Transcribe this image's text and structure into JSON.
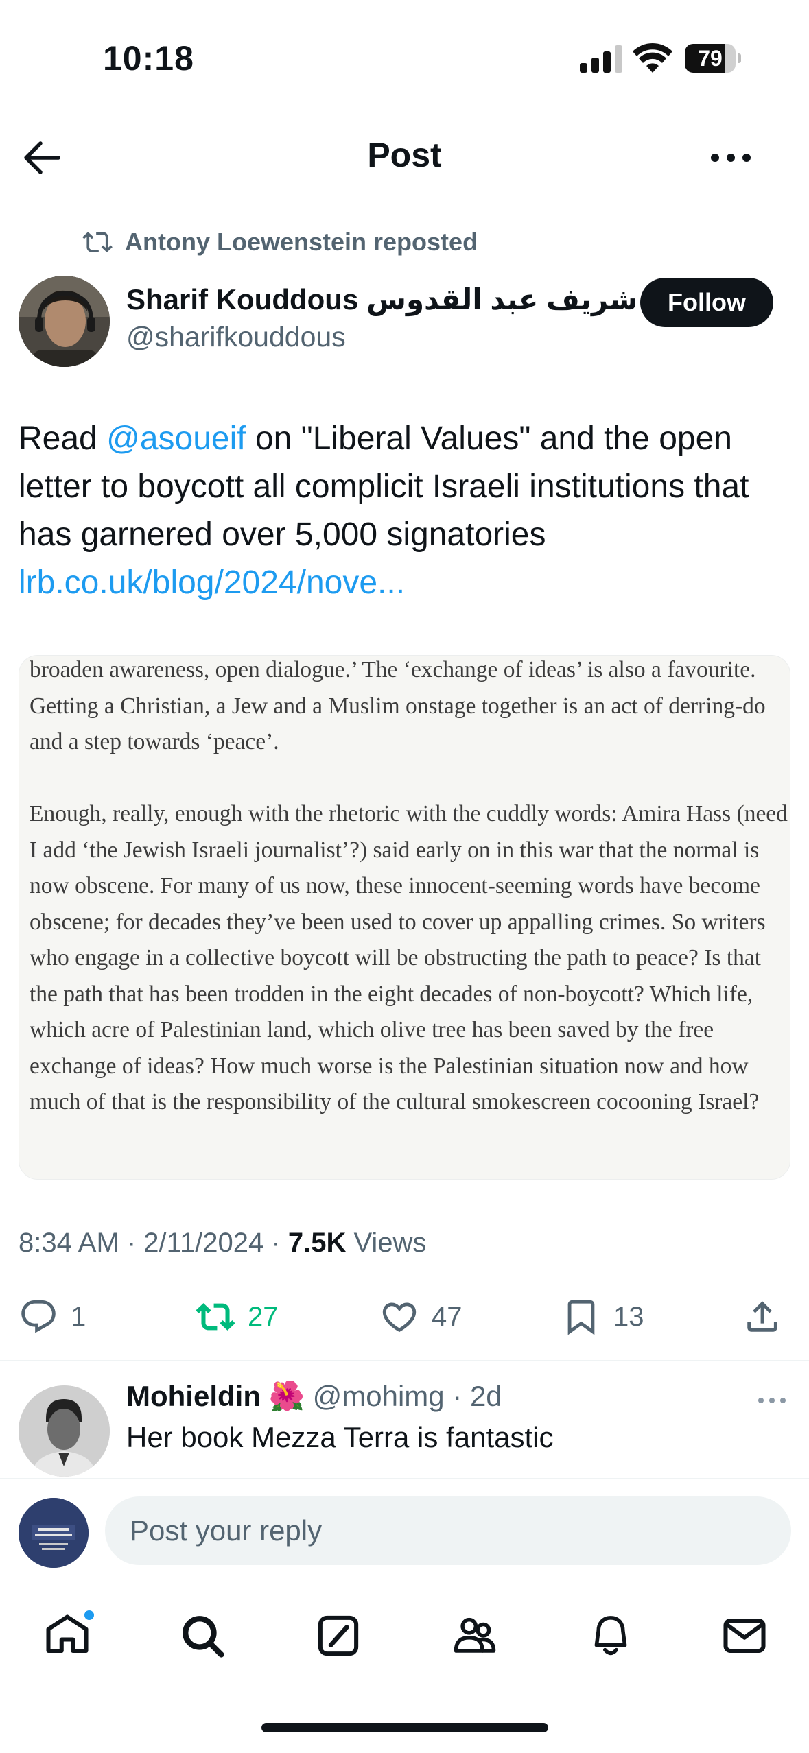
{
  "status_bar": {
    "time": "10:18",
    "battery": "79",
    "battery_level": 0.79
  },
  "header": {
    "title": "Post"
  },
  "repost": {
    "text": "Antony Loewenstein reposted"
  },
  "author": {
    "name": "Sharif Kouddous شريف عبد القدوس",
    "handle": "@sharifkouddous",
    "follow_label": "Follow"
  },
  "tweet": {
    "text_before_mention": "Read ",
    "mention": "@asoueif",
    "text_after_mention": " on \"Liberal Values\" and the open letter to boycott all complicit Israeli institutions that has garnered over 5,000 signatories",
    "link": "lrb.co.uk/blog/2024/nove..."
  },
  "image": {
    "paragraph1": "broaden awareness, open dialogue.’ The ‘exchange of ideas’ is also a favourite. Getting a Christian, a Jew and a Muslim onstage together is an act of derring-do and a step towards ‘peace’.",
    "paragraph2": "Enough, really, enough with the rhetoric with the cuddly words: Amira Hass (need I add ‘the Jewish Israeli journalist’?) said early on in this war that the normal is now obscene. For many of us now, these innocent-seeming words have become obscene; for decades they’ve been used to cover up appalling crimes. So writers who engage in a collective boycott will be obstructing the path to peace? Is that the path that has been trodden in the eight decades of non-boycott? Which life, which acre of Palestinian land, which olive tree has been saved by the free exchange of ideas? How much worse is the Palestinian situation now and how much of that is the responsibility of the cultural smokescreen cocooning Israel?"
  },
  "meta": {
    "timestamp": "8:34 AM · 2/11/2024 · ",
    "views_count": "7.5K",
    "views_label": " Views"
  },
  "actions": {
    "replies": "1",
    "reposts": "27",
    "likes": "47",
    "bookmarks": "13"
  },
  "reply": {
    "name": "Mohieldin 🌺",
    "handle_time": " @mohimg · 2d",
    "text": "Her book Mezza Terra is fantastic"
  },
  "compose": {
    "placeholder": "Post your reply"
  },
  "colors": {
    "link": "#1d9bf0",
    "retweet": "#00ba7c",
    "text": "#0f1419",
    "secondary": "#536471"
  },
  "icons": [
    "back-arrow-icon",
    "more-icon",
    "retweet-icon",
    "reply-icon",
    "heart-icon",
    "bookmark-icon",
    "share-icon",
    "home-icon",
    "search-icon",
    "grok-icon",
    "communities-icon",
    "bell-icon",
    "mail-icon"
  ]
}
